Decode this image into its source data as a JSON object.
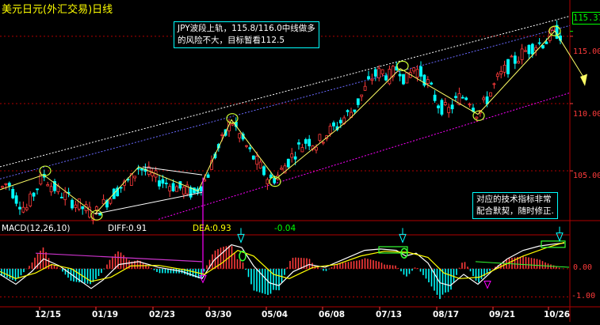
{
  "chart_data": {
    "type": "candlestick",
    "title": "美元日元(外汇交易)日线",
    "current_price_label": "115.37",
    "y_axis": {
      "ticks": [
        "115.00",
        "110.00",
        "105.00"
      ],
      "ylim": [
        101.3,
        116.7
      ]
    },
    "x_axis": {
      "ticks": [
        "12/15",
        "01/19",
        "02/23",
        "03/30",
        "05/04",
        "06/08",
        "07/13",
        "08/17",
        "09/21",
        "10/26"
      ]
    },
    "price_path": [
      [
        0,
        103.6
      ],
      [
        10,
        104.2
      ],
      [
        20,
        103.0
      ],
      [
        33,
        102.1
      ],
      [
        45,
        103.6
      ],
      [
        55,
        104.7
      ],
      [
        65,
        103.9
      ],
      [
        80,
        103.2
      ],
      [
        95,
        102.6
      ],
      [
        108,
        102.1
      ],
      [
        120,
        101.8
      ],
      [
        135,
        102.8
      ],
      [
        150,
        103.7
      ],
      [
        165,
        104.3
      ],
      [
        175,
        105.3
      ],
      [
        190,
        104.7
      ],
      [
        205,
        104.2
      ],
      [
        218,
        103.9
      ],
      [
        232,
        103.6
      ],
      [
        245,
        103.3
      ],
      [
        252,
        103.9
      ],
      [
        260,
        104.4
      ],
      [
        272,
        106.3
      ],
      [
        283,
        107.5
      ],
      [
        292,
        108.8
      ],
      [
        302,
        107.7
      ],
      [
        315,
        106.4
      ],
      [
        328,
        105.3
      ],
      [
        340,
        104.3
      ],
      [
        350,
        104.6
      ],
      [
        362,
        105.6
      ],
      [
        375,
        106.6
      ],
      [
        388,
        107.3
      ],
      [
        400,
        107.0
      ],
      [
        412,
        107.8
      ],
      [
        425,
        108.3
      ],
      [
        435,
        109.0
      ],
      [
        447,
        109.6
      ],
      [
        460,
        111.0
      ],
      [
        470,
        112.0
      ],
      [
        482,
        112.4
      ],
      [
        492,
        112.0
      ],
      [
        503,
        112.8
      ],
      [
        512,
        111.6
      ],
      [
        522,
        112.7
      ],
      [
        532,
        112.2
      ],
      [
        542,
        111.3
      ],
      [
        552,
        110.0
      ],
      [
        565,
        109.4
      ],
      [
        578,
        110.4
      ],
      [
        590,
        110.6
      ],
      [
        603,
        109.2
      ],
      [
        615,
        110.4
      ],
      [
        628,
        111.8
      ],
      [
        640,
        112.7
      ],
      [
        653,
        113.4
      ],
      [
        665,
        114.0
      ],
      [
        677,
        114.4
      ],
      [
        688,
        114.6
      ],
      [
        700,
        115.4
      ],
      [
        710,
        115.0
      ]
    ],
    "annotations": [
      {
        "text": [
          "JPY波段上轨，115.8/116.0中线做多",
          "的风险不大，目标暂看112.5"
        ]
      },
      {
        "text": [
          "对应的技术指标非常",
          "配合默契，随时修正."
        ]
      }
    ],
    "indicator": {
      "name": "MACD(12,26,10)",
      "diff_label": "DIFF:0.91",
      "dea_label": "DEA:0.93",
      "macd_label": "-0.04",
      "y_ticks": [
        "0.00",
        "-1.00"
      ],
      "ylim": [
        -1.35,
        1.2
      ],
      "diff_path": [
        [
          0,
          -0.2
        ],
        [
          20,
          -0.55
        ],
        [
          40,
          -0.1
        ],
        [
          55,
          0.35
        ],
        [
          75,
          0.1
        ],
        [
          95,
          -0.3
        ],
        [
          115,
          -0.7
        ],
        [
          130,
          -0.4
        ],
        [
          150,
          0.15
        ],
        [
          175,
          0.25
        ],
        [
          200,
          0.05
        ],
        [
          230,
          -0.1
        ],
        [
          255,
          -0.35
        ],
        [
          270,
          0.3
        ],
        [
          292,
          0.85
        ],
        [
          305,
          0.75
        ],
        [
          320,
          0.1
        ],
        [
          340,
          -0.5
        ],
        [
          352,
          -0.6
        ],
        [
          370,
          -0.1
        ],
        [
          390,
          0.15
        ],
        [
          410,
          0.05
        ],
        [
          435,
          0.35
        ],
        [
          460,
          0.65
        ],
        [
          480,
          0.7
        ],
        [
          500,
          0.65
        ],
        [
          512,
          0.45
        ],
        [
          525,
          0.55
        ],
        [
          540,
          0.2
        ],
        [
          555,
          -0.5
        ],
        [
          568,
          -0.6
        ],
        [
          585,
          -0.2
        ],
        [
          603,
          -0.55
        ],
        [
          620,
          -0.1
        ],
        [
          640,
          0.35
        ],
        [
          660,
          0.65
        ],
        [
          680,
          0.8
        ],
        [
          700,
          0.88
        ],
        [
          712,
          0.91
        ]
      ],
      "dea_path": [
        [
          0,
          -0.1
        ],
        [
          20,
          -0.35
        ],
        [
          45,
          -0.15
        ],
        [
          65,
          0.15
        ],
        [
          90,
          0.0
        ],
        [
          115,
          -0.45
        ],
        [
          140,
          -0.3
        ],
        [
          165,
          0.1
        ],
        [
          200,
          0.12
        ],
        [
          235,
          -0.05
        ],
        [
          258,
          -0.2
        ],
        [
          280,
          0.2
        ],
        [
          300,
          0.65
        ],
        [
          320,
          0.45
        ],
        [
          345,
          -0.2
        ],
        [
          365,
          -0.35
        ],
        [
          395,
          0.05
        ],
        [
          425,
          0.15
        ],
        [
          455,
          0.45
        ],
        [
          485,
          0.62
        ],
        [
          515,
          0.58
        ],
        [
          540,
          0.4
        ],
        [
          560,
          -0.15
        ],
        [
          580,
          -0.35
        ],
        [
          605,
          -0.3
        ],
        [
          630,
          0.05
        ],
        [
          660,
          0.45
        ],
        [
          690,
          0.75
        ],
        [
          712,
          0.93
        ]
      ]
    }
  }
}
